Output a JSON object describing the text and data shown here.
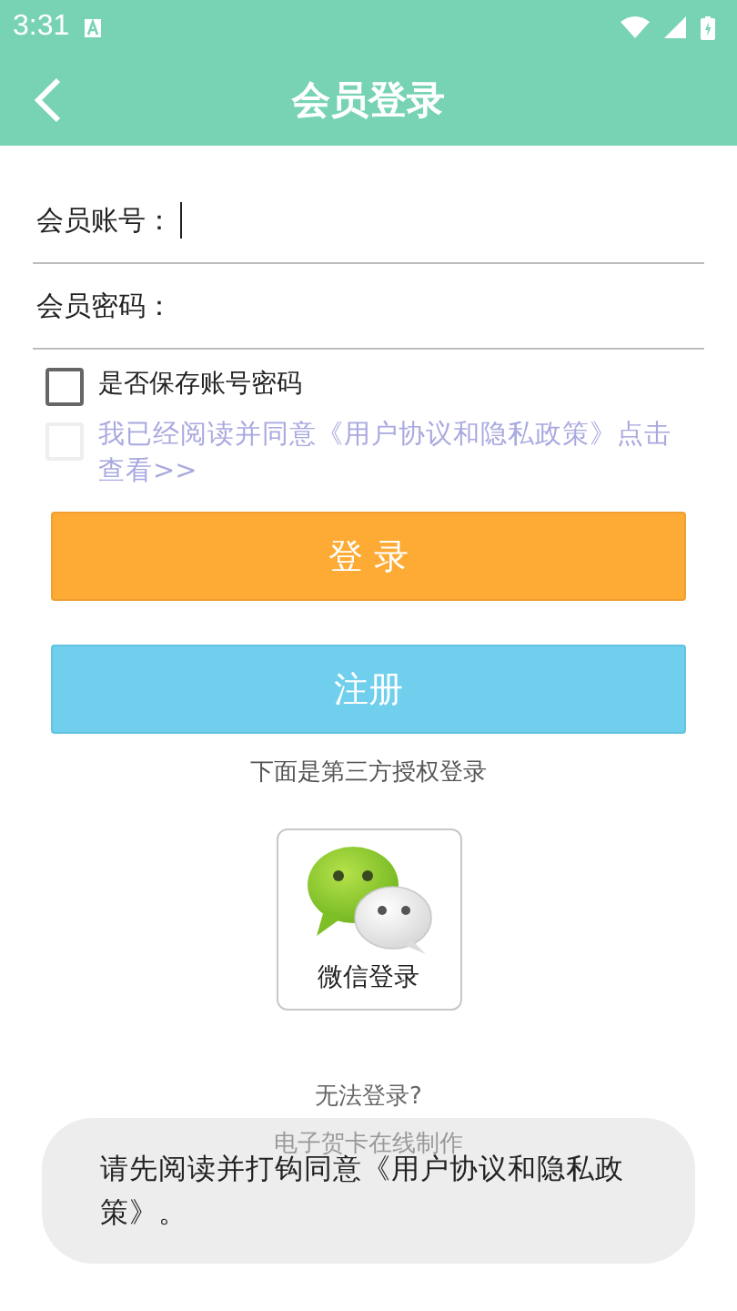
{
  "status_bar": {
    "time": "3:31"
  },
  "app_bar": {
    "title": "会员登录"
  },
  "form": {
    "fields": [
      {
        "label": "会员账号：",
        "focused": true
      },
      {
        "label": "会员密码：",
        "focused": false
      }
    ]
  },
  "options": [
    {
      "label": "是否保存账号密码",
      "checked": false,
      "disabled": false
    },
    {
      "label": "我已经阅读并同意《用户协议和隐私政策》点击查看>>",
      "checked": false,
      "disabled": true
    }
  ],
  "buttons": [
    {
      "label": "登 录",
      "kind": "primary"
    },
    {
      "label": "注册",
      "kind": "secondary"
    }
  ],
  "third_party": {
    "caption": "下面是第三方授权登录",
    "wechat_label": "微信登录"
  },
  "help_link": "无法登录?",
  "footer": "电子贺卡在线制作",
  "toast": {
    "message": "请先阅读并打钩同意《用户协议和隐私政策》。"
  }
}
